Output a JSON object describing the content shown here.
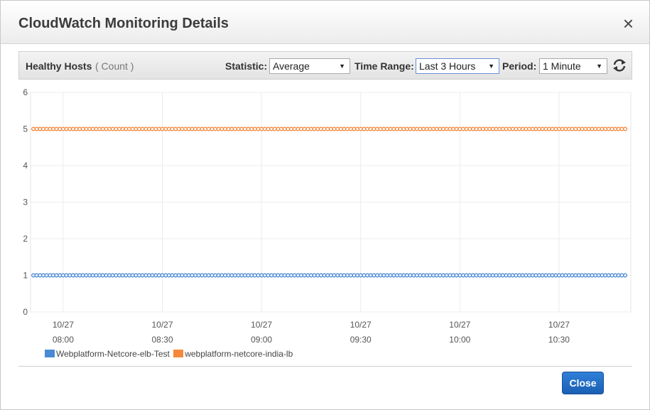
{
  "dialog": {
    "title": "CloudWatch Monitoring Details",
    "close_icon": "×",
    "close_button_label": "Close"
  },
  "toolbar": {
    "metric_name": "Healthy Hosts",
    "metric_unit": "( Count )",
    "statistic_label": "Statistic:",
    "statistic_value": "Average",
    "time_range_label": "Time Range:",
    "time_range_value": "Last 3 Hours",
    "period_label": "Period:",
    "period_value": "1 Minute",
    "refresh_icon": "refresh-icon"
  },
  "chart_data": {
    "type": "line",
    "title": "",
    "ylim": [
      0,
      6
    ],
    "yticks": [
      "0",
      "1",
      "2",
      "3",
      "4",
      "5",
      "6"
    ],
    "xticks": [
      {
        "date": "10/27",
        "time": "08:00"
      },
      {
        "date": "10/27",
        "time": "08:30"
      },
      {
        "date": "10/27",
        "time": "09:00"
      },
      {
        "date": "10/27",
        "time": "09:30"
      },
      {
        "date": "10/27",
        "time": "10:00"
      },
      {
        "date": "10/27",
        "time": "10:30"
      }
    ],
    "x_start": "10/27 07:51",
    "x_end": "10/27 10:50",
    "x_interval": "1 Minute",
    "grid": true,
    "legend_position": "bottom-left",
    "series": [
      {
        "name": "Webplatform-Netcore-elb-Test",
        "color": "#4a8ad4",
        "value": 1
      },
      {
        "name": "webplatform-netcore-india-lb",
        "color": "#f5883a",
        "value": 5
      }
    ]
  }
}
